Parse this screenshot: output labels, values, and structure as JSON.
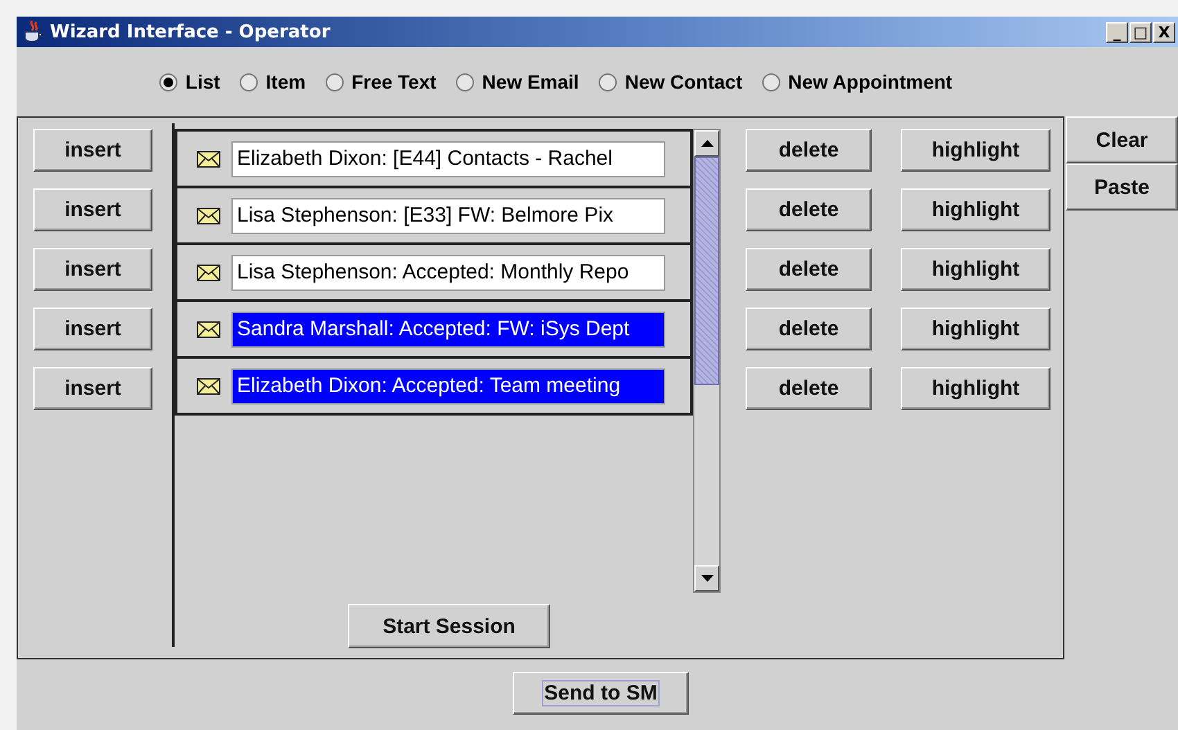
{
  "window": {
    "title": "Wizard Interface - Operator",
    "controls": [
      "_",
      "□",
      "X"
    ]
  },
  "modes": [
    {
      "label": "List",
      "selected": true
    },
    {
      "label": "Item",
      "selected": false
    },
    {
      "label": "Free Text",
      "selected": false
    },
    {
      "label": "New Email",
      "selected": false
    },
    {
      "label": "New Contact",
      "selected": false
    },
    {
      "label": "New Appointment",
      "selected": false
    }
  ],
  "insert_buttons": [
    "insert",
    "insert",
    "insert",
    "insert",
    "insert"
  ],
  "messages": [
    {
      "text": "Elizabeth Dixon: [E44] Contacts - Rachel",
      "selected": false
    },
    {
      "text": "Lisa Stephenson: [E33] FW: Belmore Pix",
      "selected": false
    },
    {
      "text": "Lisa Stephenson: Accepted: Monthly Repo",
      "selected": false
    },
    {
      "text": "Sandra Marshall: Accepted: FW: iSys Dept",
      "selected": true
    },
    {
      "text": "Elizabeth Dixon: Accepted: Team meeting",
      "selected": true
    }
  ],
  "delete_buttons": [
    "delete",
    "delete",
    "delete",
    "delete",
    "delete"
  ],
  "highlight_buttons": [
    "highlight",
    "highlight",
    "highlight",
    "highlight",
    "highlight"
  ],
  "side_buttons": [
    "Clear",
    "Paste"
  ],
  "start_button": "Start Session",
  "send_button": "Send to SM"
}
